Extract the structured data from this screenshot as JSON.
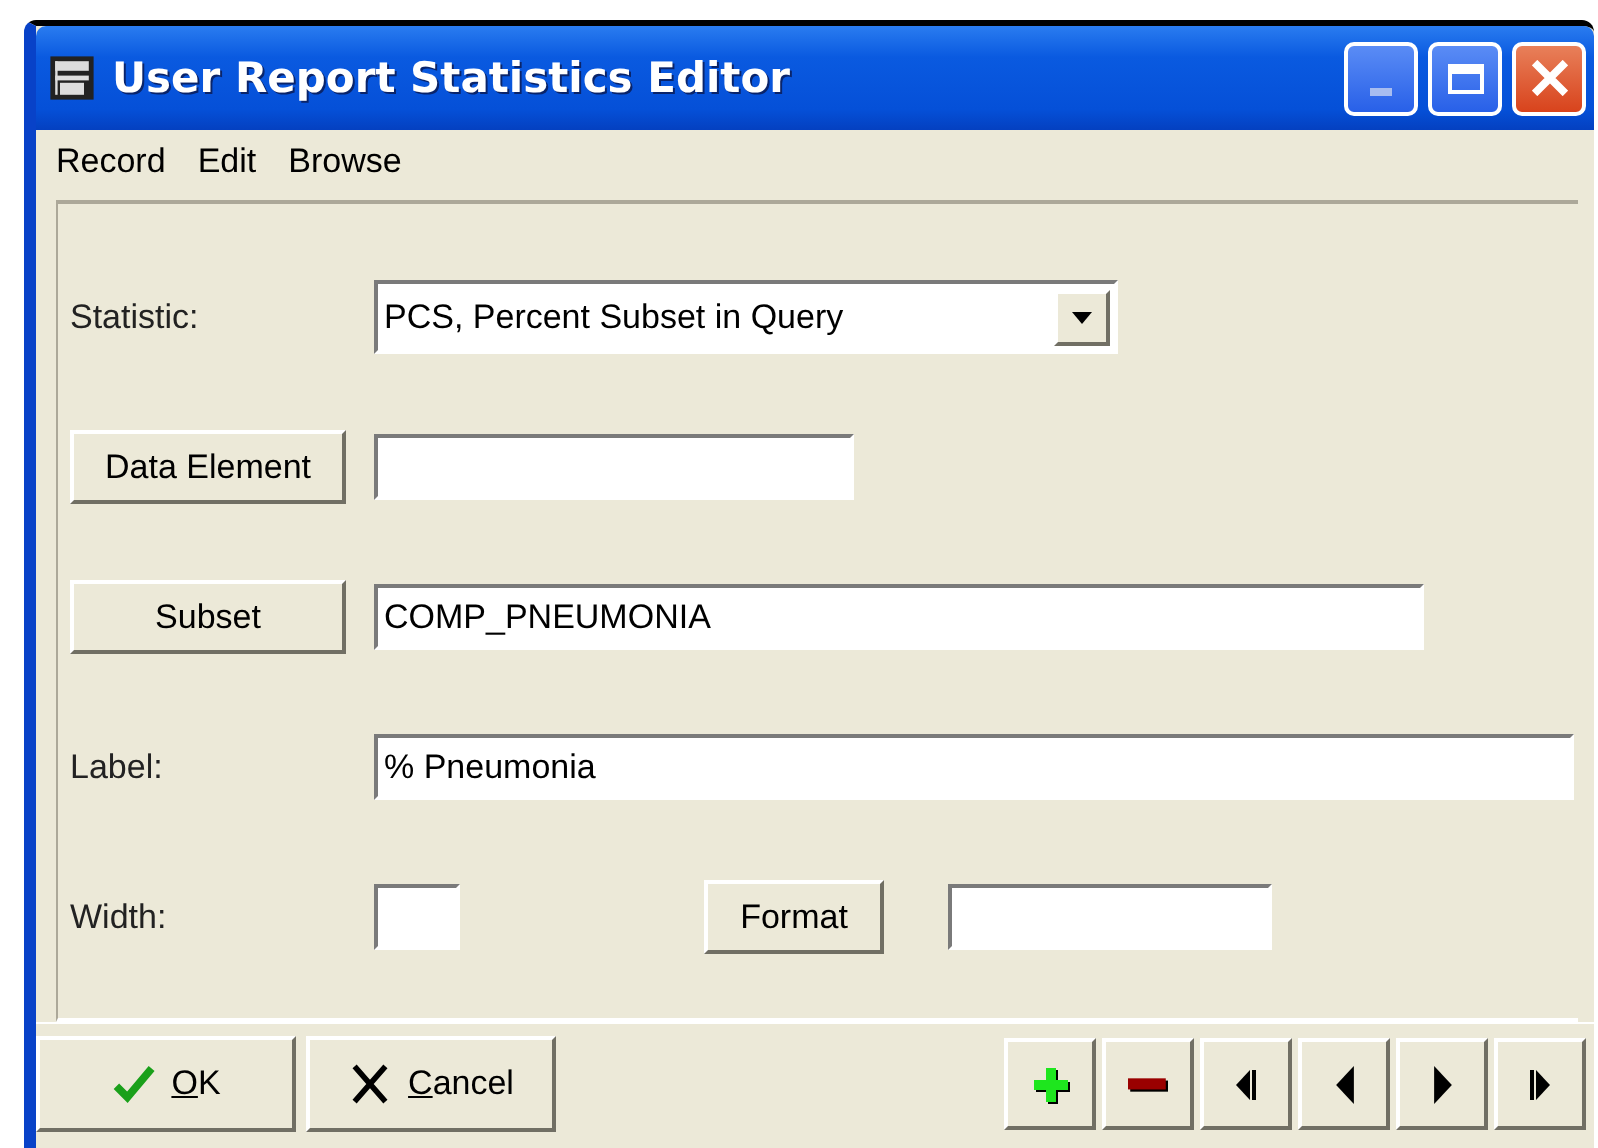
{
  "window": {
    "title": "User Report Statistics Editor"
  },
  "menu": [
    "Record",
    "Edit",
    "Browse"
  ],
  "form": {
    "rows": [
      {
        "kind": "combo",
        "label": "Statistic:",
        "value": "PCS, Percent Subset in Query"
      },
      {
        "kind": "button-field",
        "label": "Data Element"
      },
      {
        "kind": "button-field",
        "label": "Subset",
        "value": "COMP_PNEUMONIA"
      },
      {
        "kind": "field",
        "label": "Label:",
        "value": "% Pneumonia"
      },
      {
        "kind": "width-format",
        "label": "Width:",
        "button": "Format"
      }
    ]
  },
  "buttons": [
    {
      "kind": "ok",
      "label": "OK"
    },
    {
      "kind": "cancel",
      "label": "Cancel"
    }
  ],
  "nav_buttons": [
    {
      "kind": "add"
    },
    {
      "kind": "delete"
    },
    {
      "kind": "first"
    },
    {
      "kind": "prev"
    },
    {
      "kind": "next"
    },
    {
      "kind": "last"
    }
  ]
}
